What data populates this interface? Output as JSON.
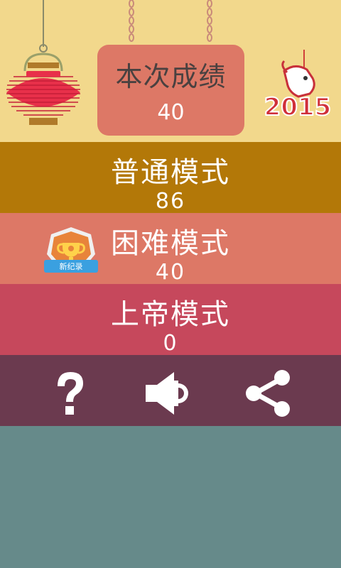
{
  "score_card": {
    "label": "本次成绩",
    "value": "40"
  },
  "badge": {
    "year": "2015"
  },
  "modes": [
    {
      "title": "普通模式",
      "score": "86"
    },
    {
      "title": "困难模式",
      "score": "40",
      "new_record": "新纪录"
    },
    {
      "title": "上帝模式",
      "score": "0"
    }
  ],
  "toolbar": {
    "help_icon": "question-mark-icon",
    "sound_icon": "speaker-icon",
    "share_icon": "share-icon"
  },
  "colors": {
    "header_bg": "#f2d88c",
    "score_card": "#dd7866",
    "normal_mode": "#b37808",
    "hard_mode": "#dd7866",
    "god_mode": "#c6485c",
    "toolbar": "#6b3a4f",
    "bottom": "#668a8a"
  }
}
